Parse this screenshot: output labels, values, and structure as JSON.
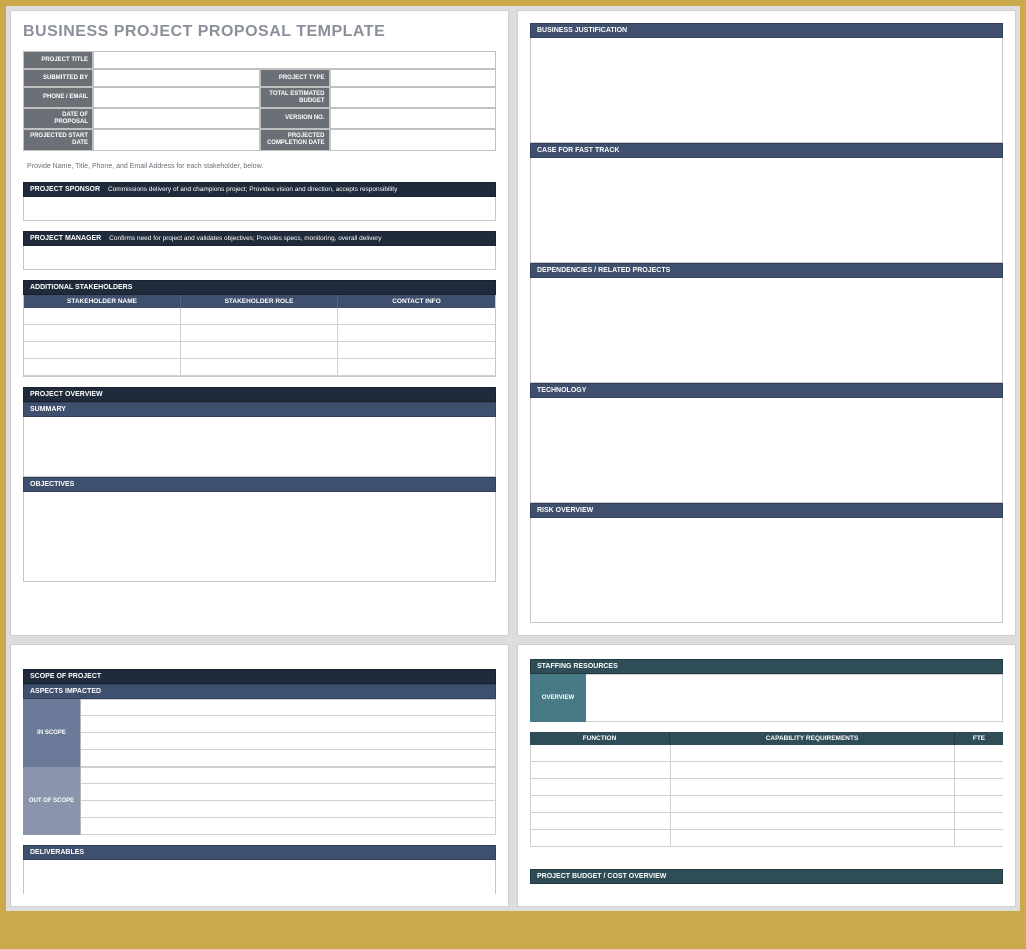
{
  "title": "BUSINESS PROJECT PROPOSAL TEMPLATE",
  "info": {
    "project_title": "PROJECT TITLE",
    "submitted_by": "SUBMITTED BY",
    "project_type": "PROJECT TYPE",
    "phone_email": "PHONE / EMAIL",
    "total_estimated_budget": "TOTAL ESTIMATED BUDGET",
    "date_of_proposal": "DATE OF PROPOSAL",
    "version_no": "VERSION NO.",
    "projected_start_date": "PROJECTED START DATE",
    "projected_completion_date": "PROJECTED COMPLETION DATE"
  },
  "instruction": "Provide Name, Title, Phone, and Email Address for each stakeholder, below.",
  "sponsor": {
    "label": "PROJECT SPONSOR",
    "desc": "Commissions delivery of and champions project; Provides vision and direction, accepts responsibility"
  },
  "manager": {
    "label": "PROJECT MANAGER",
    "desc": "Confirms need for project and validates objectives; Provides specs, monitoring, overall delivery"
  },
  "stakeholders": {
    "header": "ADDITIONAL STAKEHOLDERS",
    "cols": [
      "STAKEHOLDER NAME",
      "STAKEHOLDER ROLE",
      "CONTACT INFO"
    ]
  },
  "overview": {
    "header": "PROJECT OVERVIEW",
    "summary": "SUMMARY",
    "objectives": "OBJECTIVES"
  },
  "sections": {
    "business_justification": "BUSINESS JUSTIFICATION",
    "case_fast_track": "CASE FOR FAST TRACK",
    "dependencies": "DEPENDENCIES / RELATED PROJECTS",
    "technology": "TECHNOLOGY",
    "risk_overview": "RISK OVERVIEW"
  },
  "scope": {
    "header": "SCOPE OF PROJECT",
    "aspects": "ASPECTS IMPACTED",
    "in_scope": "IN SCOPE",
    "out_scope": "OUT OF SCOPE",
    "deliverables": "DELIVERABLES"
  },
  "staffing": {
    "header": "STAFFING RESOURCES",
    "overview": "OVERVIEW",
    "cols": [
      "FUNCTION",
      "CAPABILITY REQUIREMENTS",
      "FTE"
    ],
    "budget": "PROJECT BUDGET / COST OVERVIEW"
  }
}
